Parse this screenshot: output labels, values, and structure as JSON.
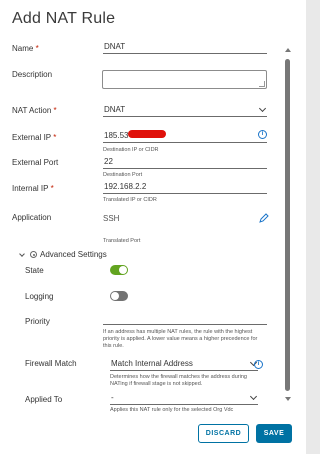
{
  "dialog": {
    "title": "Add NAT Rule",
    "discard_label": "DISCARD",
    "save_label": "SAVE"
  },
  "fields": {
    "name": {
      "label": "Name",
      "required": "*",
      "value": "DNAT"
    },
    "description": {
      "label": "Description",
      "value": ""
    },
    "nat_action": {
      "label": "NAT Action",
      "required": "*",
      "value": "DNAT"
    },
    "external_ip": {
      "label": "External IP",
      "required": "*",
      "value": "185.53",
      "helper": "Destination IP or CIDR"
    },
    "external_port": {
      "label": "External Port",
      "value": "22",
      "helper": "Destination Port"
    },
    "internal_ip": {
      "label": "Internal IP",
      "required": "*",
      "value": "192.168.2.2",
      "helper": "Translated IP or CIDR"
    },
    "application": {
      "label": "Application",
      "value": "SSH",
      "helper": "Translated Port"
    }
  },
  "advanced": {
    "label": "Advanced Settings",
    "state": {
      "label": "State",
      "on": true
    },
    "logging": {
      "label": "Logging",
      "on": false
    },
    "priority": {
      "label": "Priority",
      "helper": "If an address has multiple NAT rules, the rule with the highest priority is applied. A lower value means a higher precedence for this rule."
    },
    "firewall_match": {
      "label": "Firewall Match",
      "value": "Match Internal Address",
      "helper": "Determines how the firewall matches the address during NATing if firewall stage is not skipped."
    },
    "applied_to": {
      "label": "Applied To",
      "value": "-",
      "helper": "Applies this NAT rule only for the selected Org Vdc"
    }
  },
  "colors": {
    "primary": "#0072a3",
    "toggle_on": "#62a420",
    "required": "#c21d00",
    "info": "#1a74c9"
  }
}
